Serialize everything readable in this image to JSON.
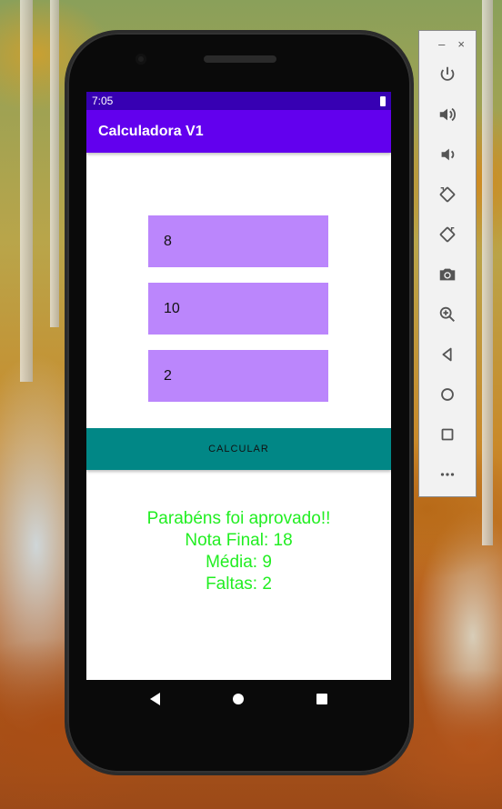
{
  "status_bar": {
    "time": "7:05"
  },
  "app_bar": {
    "title": "Calculadora V1"
  },
  "inputs": [
    {
      "value": "8"
    },
    {
      "value": "10"
    },
    {
      "value": "2"
    }
  ],
  "calculate_button": {
    "label": "CALCULAR"
  },
  "result": {
    "line1": "Parabéns foi aprovado!!",
    "line2": "Nota Final: 18",
    "line3": "Média: 9",
    "line4": "Faltas: 2"
  },
  "colors": {
    "status_bar": "#3700b3",
    "app_bar": "#6200ee",
    "input_bg": "#bb86fc",
    "button_bg": "#018786",
    "result_text": "#22ee22"
  },
  "emulator_toolbar": {
    "minimize_label": "–",
    "close_label": "×",
    "buttons": [
      "power-icon",
      "volume-up-icon",
      "volume-down-icon",
      "rotate-left-icon",
      "rotate-right-icon",
      "camera-icon",
      "zoom-icon",
      "back-icon",
      "home-icon",
      "overview-icon",
      "more-icon"
    ]
  }
}
